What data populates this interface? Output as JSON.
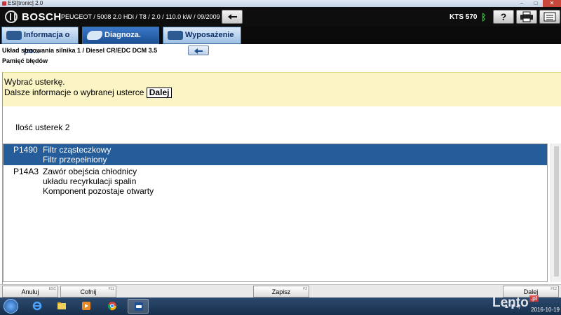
{
  "window": {
    "title": "ESI[tronic] 2.0",
    "minimize": "–",
    "maximize": "□",
    "close": "✕"
  },
  "header": {
    "brand": "BOSCH",
    "vehicle": "PEUGEOT / 5008 2.0 HDi / T8 / 2.0 / 110.0 kW / 09/2009 - / RHE",
    "device": "KTS 570",
    "back_icon": "back-arrow-icon",
    "bluetooth_icon": "bluetooth-icon",
    "help_label": "?",
    "print_icon": "printer-icon",
    "menu_icon": "menu-list-icon"
  },
  "tabs": [
    {
      "label": "Informacja o po...",
      "icon": "car-info-icon",
      "active": false
    },
    {
      "label": "Diagnoza.",
      "icon": "diagnosis-icon",
      "active": true
    },
    {
      "label": "Wyposażenie",
      "icon": "equipment-icon",
      "active": false
    }
  ],
  "breadcrumb": {
    "path": "Układ sterowania silnika 1 / Diesel CR/EDC DCM 3.5",
    "section": "Pamięć błędów"
  },
  "notice": {
    "line1": "Wybrać usterkę.",
    "line2": "Dalsze informacje o wybranej usterce",
    "button": "Dalej"
  },
  "fault_count": "Ilość usterek 2",
  "faults": [
    {
      "code": "P1490",
      "lines": [
        "Filtr cząsteczkowy",
        "Filtr przepełniony"
      ],
      "selected": true
    },
    {
      "code": "P14A3",
      "lines": [
        "Zawór obejścia chłodnicy",
        "układu recyrkulacji spalin",
        "Komponent pozostaje otwarty"
      ],
      "selected": false
    }
  ],
  "footer_buttons": [
    {
      "label": "Anuluj",
      "key": "ESC"
    },
    {
      "label": "Cofnij",
      "key": "F11"
    },
    {
      "label": "Zapisz",
      "key": "F2"
    },
    {
      "label": "Dalej",
      "key": "F12"
    }
  ],
  "taskbar": {
    "apps": [
      "internet-explorer-icon",
      "file-explorer-icon",
      "media-player-icon",
      "chrome-icon",
      "esitronic-icon"
    ],
    "tray_icons": "▲ ▮ ◂) ",
    "date": "2016-10-19"
  },
  "watermark": {
    "text": "Lento",
    "suffix": ".pl"
  },
  "colors": {
    "header_bg": "#0e0e0e",
    "active_tab": "#1b4f95",
    "selected_row": "#245d9a",
    "notice_bg": "#fbf5c6"
  }
}
